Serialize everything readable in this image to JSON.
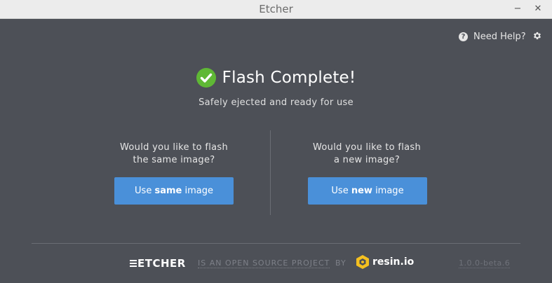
{
  "window": {
    "title": "Etcher"
  },
  "header": {
    "help_label": "Need Help?",
    "help_icon": "question-circle-icon",
    "settings_icon": "gear-icon"
  },
  "status": {
    "title": "Flash Complete!",
    "subtitle": "Safely ejected and ready for use",
    "icon": "check-circle-icon",
    "accent_color": "#5fb835"
  },
  "options": {
    "same": {
      "question_line1": "Would you like to flash",
      "question_line2": "the same image?",
      "button_prefix": "Use ",
      "button_emphasis": "same",
      "button_suffix": " image"
    },
    "new": {
      "question_line1": "Would you like to flash",
      "question_line2": "a new image?",
      "button_prefix": "Use ",
      "button_emphasis": "new",
      "button_suffix": " image"
    },
    "button_color": "#4a90d9"
  },
  "footer": {
    "etcher_logo_text": "ETCHER",
    "open_source_text": "IS AN OPEN SOURCE PROJECT",
    "by_text": "BY",
    "resin_logo_text": "resin.io",
    "version": "1.0.0-beta.6"
  },
  "colors": {
    "background": "#4d5057",
    "titlebar": "#ececec"
  }
}
